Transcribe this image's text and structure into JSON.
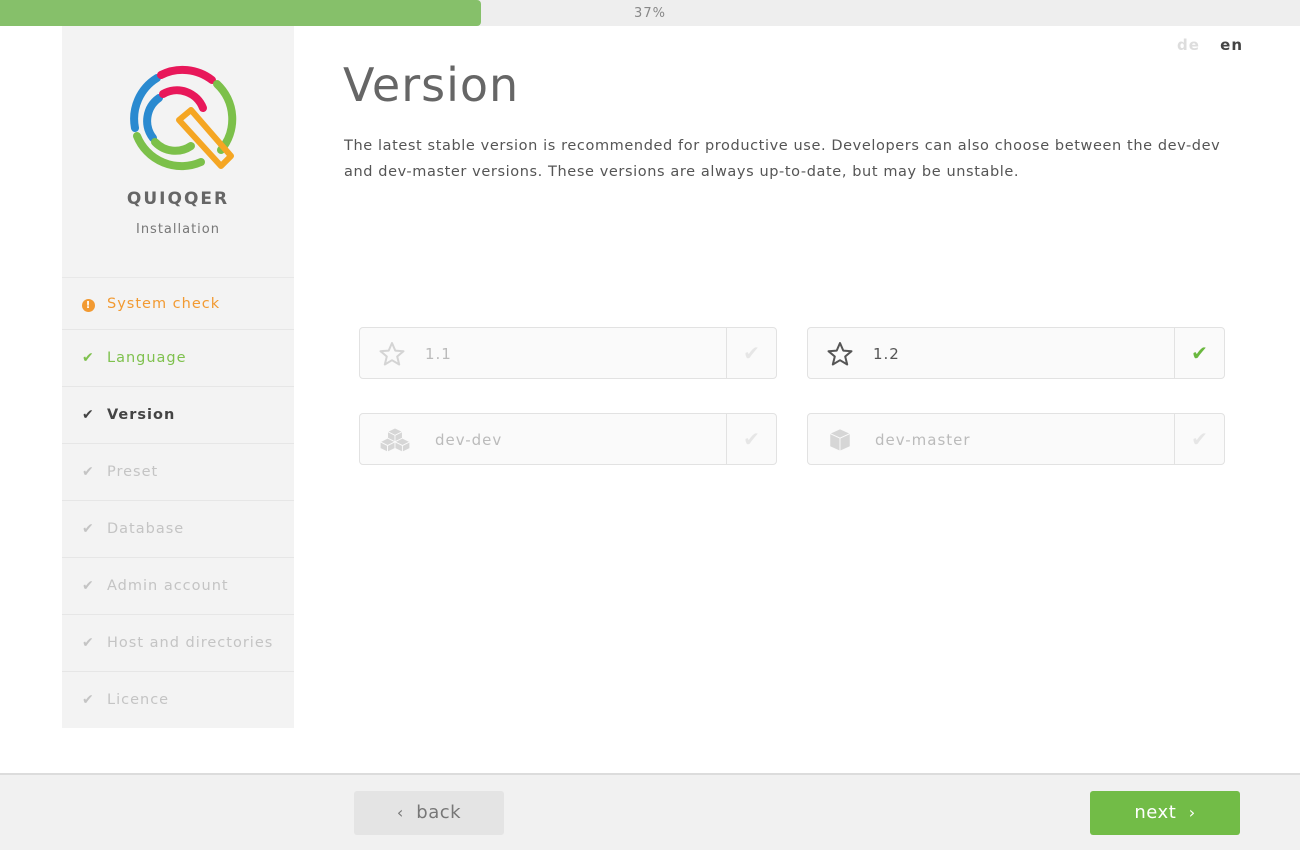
{
  "progress": {
    "percent_text": "37%",
    "fraction": 0.37,
    "fill_color": "#86c06a"
  },
  "brand": {
    "name": "QUIQQER",
    "subtitle": "Installation"
  },
  "steps": [
    {
      "label": "System check",
      "state": "warning",
      "icon": "exclamation-circle-icon"
    },
    {
      "label": "Language",
      "state": "done",
      "icon": "check-icon"
    },
    {
      "label": "Version",
      "state": "active",
      "icon": "check-icon"
    },
    {
      "label": "Preset",
      "state": "pending",
      "icon": "check-icon"
    },
    {
      "label": "Database",
      "state": "pending",
      "icon": "check-icon"
    },
    {
      "label": "Admin account",
      "state": "pending",
      "icon": "check-icon"
    },
    {
      "label": "Host and directories",
      "state": "pending",
      "icon": "check-icon"
    },
    {
      "label": "Licence",
      "state": "pending",
      "icon": "check-icon"
    }
  ],
  "language": {
    "de": "de",
    "en": "en",
    "selected": "en"
  },
  "page": {
    "title": "Version",
    "description": "The latest stable version is recommended for productive use. Developers can also choose between the dev-dev and dev-master versions. These versions are always up-to-date, but may be unstable."
  },
  "versions": [
    {
      "label": "1.1",
      "icon": "star-outline-icon",
      "selected": false
    },
    {
      "label": "1.2",
      "icon": "star-outline-icon",
      "selected": true
    },
    {
      "label": "dev-dev",
      "icon": "cubes-icon",
      "selected": false
    },
    {
      "label": "dev-master",
      "icon": "cube-icon",
      "selected": false
    }
  ],
  "footer": {
    "back_label": "back",
    "next_label": "next"
  },
  "colors": {
    "accent_green": "#72bc47",
    "warning_orange": "#f29a32"
  }
}
